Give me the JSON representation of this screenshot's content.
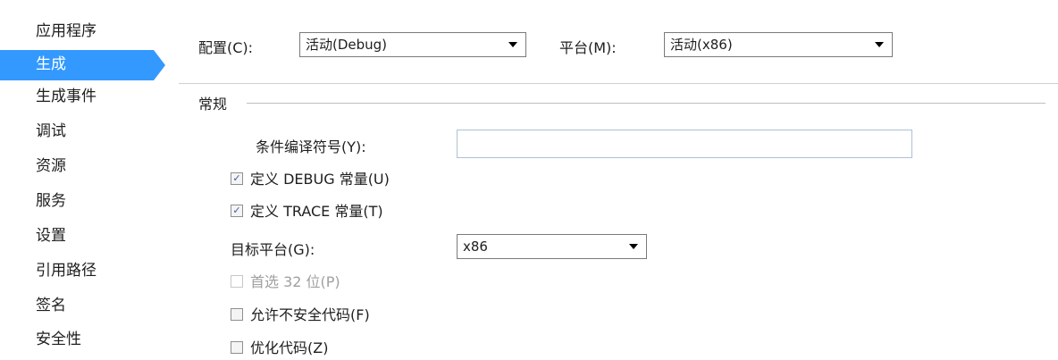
{
  "sidebar": {
    "items": [
      {
        "label": "应用程序"
      },
      {
        "label": "生成"
      },
      {
        "label": "生成事件"
      },
      {
        "label": "调试"
      },
      {
        "label": "资源"
      },
      {
        "label": "服务"
      },
      {
        "label": "设置"
      },
      {
        "label": "引用路径"
      },
      {
        "label": "签名"
      },
      {
        "label": "安全性"
      }
    ],
    "selected": "生成"
  },
  "config_bar": {
    "configuration_label": "配置(C):",
    "configuration_value": "活动(Debug)",
    "platform_label": "平台(M):",
    "platform_value": "活动(x86)"
  },
  "general": {
    "section_title": "常规",
    "conditional_symbols_label": "条件编译符号(Y):",
    "conditional_symbols_value": "",
    "define_debug": {
      "label": "定义 DEBUG 常量(U)",
      "checked": true
    },
    "define_trace": {
      "label": "定义 TRACE 常量(T)",
      "checked": true
    },
    "platform_target_label": "目标平台(G):",
    "platform_target_value": "x86",
    "prefer_32bit": {
      "label": "首选 32 位(P)",
      "checked": false,
      "enabled": false
    },
    "allow_unsafe": {
      "label": "允许不安全代码(F)",
      "checked": false
    },
    "optimize": {
      "label": "优化代码(Z)",
      "checked": false
    }
  },
  "colors": {
    "selection": "#3399ff",
    "checkmark": "#3c5a99"
  }
}
